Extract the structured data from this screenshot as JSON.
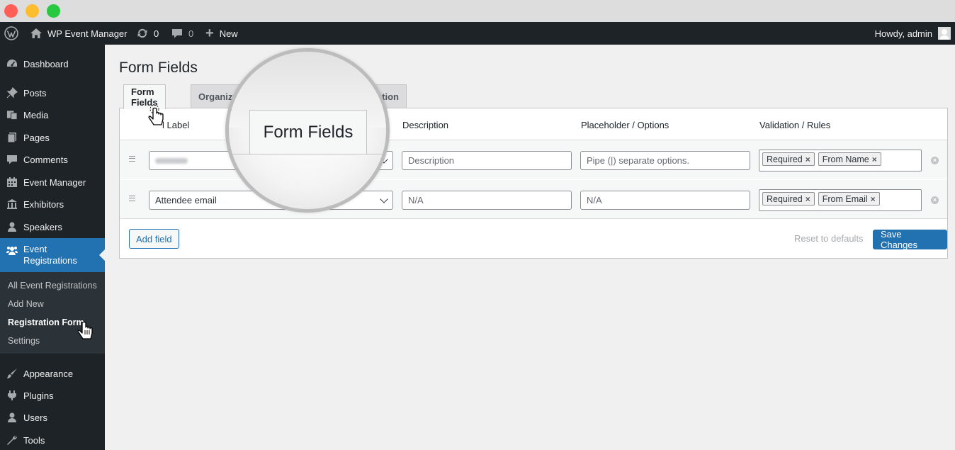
{
  "window": {
    "controls": [
      "close",
      "minimize",
      "zoom"
    ]
  },
  "adminbar": {
    "site_name": "WP Event Manager",
    "updates_count": "0",
    "comments_count": "0",
    "new_label": "New",
    "howdy": "Howdy, admin"
  },
  "sidebar": {
    "items": [
      {
        "label": "Dashboard",
        "icon": "dashboard-icon"
      },
      {
        "label": "Posts",
        "icon": "pin-icon"
      },
      {
        "label": "Media",
        "icon": "media-icon"
      },
      {
        "label": "Pages",
        "icon": "pages-icon"
      },
      {
        "label": "Comments",
        "icon": "comment-icon"
      },
      {
        "label": "Event Manager",
        "icon": "calendar-icon"
      },
      {
        "label": "Exhibitors",
        "icon": "bank-icon"
      },
      {
        "label": "Speakers",
        "icon": "user-icon"
      },
      {
        "label": "Event Registrations",
        "icon": "groups-icon"
      },
      {
        "label": "Appearance",
        "icon": "brush-icon"
      },
      {
        "label": "Plugins",
        "icon": "plugin-icon"
      },
      {
        "label": "Users",
        "icon": "users-icon"
      },
      {
        "label": "Tools",
        "icon": "wrench-icon"
      }
    ],
    "submenu": [
      "All Event Registrations",
      "Add New",
      "Registration Form",
      "Settings"
    ],
    "active_submenu": "Registration Form"
  },
  "page": {
    "title": "Form Fields",
    "tabs": [
      "Form Fields",
      "Organize",
      "tion"
    ],
    "active_tab": "Form Fields"
  },
  "table": {
    "headers": {
      "label": "l Label",
      "description": "Description",
      "placeholder": "Placeholder / Options",
      "validation": "Validation / Rules"
    },
    "rows": [
      {
        "label": "",
        "label_blurred": true,
        "description": "Description",
        "description_is_placeholder": true,
        "placeholder": "Pipe (|) separate options.",
        "placeholder_is_placeholder": true,
        "rules": [
          "Required",
          "From Name"
        ]
      },
      {
        "label": "Attendee email",
        "label_blurred": false,
        "type_fragment": "ail",
        "description": "N/A",
        "description_is_placeholder": true,
        "placeholder": "N/A",
        "placeholder_is_placeholder": true,
        "rules": [
          "Required",
          "From Email"
        ]
      }
    ],
    "tag_remove_symbol": "×",
    "row_remove_symbol": "×"
  },
  "actions": {
    "add_field": "Add field",
    "reset": "Reset to defaults",
    "save": "Save Changes"
  },
  "magnifier": {
    "text": "Form Fields"
  },
  "colors": {
    "admin_dark": "#1d2327",
    "accent": "#2271b1",
    "page_bg": "#f0f0f1"
  }
}
